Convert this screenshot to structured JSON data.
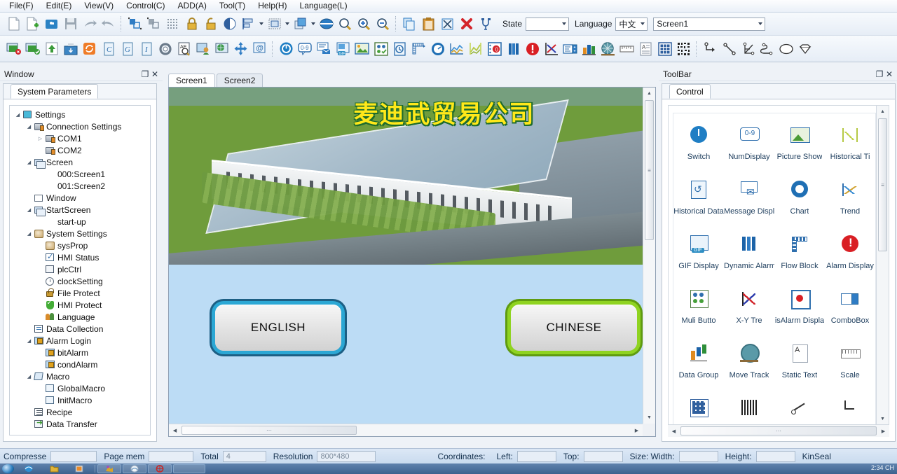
{
  "menu": {
    "items": [
      {
        "label": "File(F)",
        "name": "menu-file"
      },
      {
        "label": "Edit(E)",
        "name": "menu-edit"
      },
      {
        "label": "View(V)",
        "name": "menu-view"
      },
      {
        "label": "Control(C)",
        "name": "menu-control"
      },
      {
        "label": "ADD(A)",
        "name": "menu-add"
      },
      {
        "label": "Tool(T)",
        "name": "menu-tool"
      },
      {
        "label": "Help(H)",
        "name": "menu-help"
      },
      {
        "label": "Language(L)",
        "name": "menu-language"
      }
    ]
  },
  "toolbar_main": {
    "state_label": "State",
    "state_value": "",
    "language_label": "Language",
    "language_value": "中文",
    "screen_value": "Screen1",
    "icons": [
      "new-file-icon",
      "new-project-icon",
      "open-project-icon",
      "save-icon",
      "redo-icon",
      "undo-icon",
      "sep",
      "select-object-icon",
      "group-object-icon",
      "grid-icon",
      "lock-icon",
      "unlock-icon",
      "flip-icon",
      "align-icon",
      "caret",
      "size-icon",
      "caret",
      "layer-icon",
      "caret",
      "fill-icon",
      "zoom-icon",
      "zoom-in-icon",
      "zoom-out-icon",
      "sep",
      "copy-icon",
      "paste-icon",
      "cut-icon",
      "delete-icon",
      "find-icon"
    ]
  },
  "toolbar_second": {
    "icons": [
      "compile-error-icon",
      "compile-ok-icon",
      "upload-icon",
      "usb-download-icon",
      "refresh-icon",
      "c-script-icon",
      "g-script-icon",
      "i-script-icon",
      "settings-gear-icon",
      "text-search-icon",
      "user-manage-icon",
      "network-icon",
      "move-icon",
      "at-address-icon",
      "sep",
      "switch-icon",
      "numdisplay-icon",
      "message-display-icon",
      "gif-display-icon",
      "picture-show-icon",
      "multi-button-icon",
      "historical-data-icon",
      "flow-block-icon",
      "chart-icon",
      "trend-icon",
      "historical-trend-icon",
      "is-alarm-display-icon",
      "dynamic-alarm-list-icon",
      "alarm-display-icon",
      "xy-trend-icon",
      "combobox-icon",
      "data-group-icon",
      "move-track-icon",
      "scale-icon",
      "static-text-icon",
      "grid-table-icon",
      "qrcode-icon",
      "sep",
      "polyline-icon",
      "line-icon",
      "polygon-icon",
      "curve-icon",
      "ellipse-icon",
      "diamond-icon"
    ]
  },
  "left_dock": {
    "title": "Window",
    "restore_icon": "restore-icon",
    "close_icon": "close-icon",
    "tab": "System Parameters",
    "tree": [
      {
        "label": "Settings",
        "depth": 0,
        "twisty": "open",
        "icon": "settings-icon"
      },
      {
        "label": "Connection Settings",
        "depth": 1,
        "twisty": "open",
        "icon": "connection-icon"
      },
      {
        "label": "COM1",
        "depth": 2,
        "twisty": "closed",
        "icon": "com-port-icon"
      },
      {
        "label": "COM2",
        "depth": 2,
        "twisty": "none",
        "icon": "com-port-icon"
      },
      {
        "label": "Screen",
        "depth": 1,
        "twisty": "open",
        "icon": "screen-icon"
      },
      {
        "label": "000:Screen1",
        "depth": 2,
        "twisty": "none",
        "icon": "none"
      },
      {
        "label": "001:Screen2",
        "depth": 2,
        "twisty": "none",
        "icon": "none"
      },
      {
        "label": "Window",
        "depth": 1,
        "twisty": "none",
        "icon": "window-icon"
      },
      {
        "label": "StartScreen",
        "depth": 1,
        "twisty": "open",
        "icon": "screen-icon"
      },
      {
        "label": "start-up",
        "depth": 2,
        "twisty": "none",
        "icon": "none"
      },
      {
        "label": "System Settings",
        "depth": 1,
        "twisty": "open",
        "icon": "system-settings-icon"
      },
      {
        "label": "sysProp",
        "depth": 2,
        "twisty": "none",
        "icon": "system-settings-icon"
      },
      {
        "label": "HMI Status",
        "depth": 2,
        "twisty": "none",
        "icon": "hmi-status-icon"
      },
      {
        "label": "plcCtrl",
        "depth": 2,
        "twisty": "none",
        "icon": "plc-ctrl-icon"
      },
      {
        "label": "clockSetting",
        "depth": 2,
        "twisty": "none",
        "icon": "clock-icon"
      },
      {
        "label": "File Protect",
        "depth": 2,
        "twisty": "none",
        "icon": "lock-icon"
      },
      {
        "label": "HMI Protect",
        "depth": 2,
        "twisty": "none",
        "icon": "shield-icon"
      },
      {
        "label": "Language",
        "depth": 2,
        "twisty": "none",
        "icon": "users-icon"
      },
      {
        "label": "Data Collection",
        "depth": 1,
        "twisty": "none",
        "icon": "data-collection-icon"
      },
      {
        "label": "Alarm Login",
        "depth": 1,
        "twisty": "open",
        "icon": "alarm-login-icon"
      },
      {
        "label": "bitAlarm",
        "depth": 2,
        "twisty": "none",
        "icon": "alarm-login-icon"
      },
      {
        "label": "condAlarm",
        "depth": 2,
        "twisty": "none",
        "icon": "alarm-login-icon"
      },
      {
        "label": "Macro",
        "depth": 1,
        "twisty": "open",
        "icon": "macro-icon"
      },
      {
        "label": "GlobalMacro",
        "depth": 2,
        "twisty": "none",
        "icon": "global-macro-icon"
      },
      {
        "label": "InitMacro",
        "depth": 2,
        "twisty": "none",
        "icon": "init-macro-icon"
      },
      {
        "label": "Recipe",
        "depth": 1,
        "twisty": "none",
        "icon": "recipe-icon"
      },
      {
        "label": "Data Transfer",
        "depth": 1,
        "twisty": "none",
        "icon": "data-transfer-icon"
      }
    ]
  },
  "editor": {
    "tabs": [
      {
        "label": "Screen1",
        "active": true
      },
      {
        "label": "Screen2",
        "active": false
      }
    ],
    "canvas": {
      "title_text": "麦迪武贸易公司",
      "buttons": [
        {
          "label": "ENGLISH",
          "accent": "#2ba7d4",
          "name": "hmi-button-english"
        },
        {
          "label": "CHINESE",
          "accent": "#8fd321",
          "name": "hmi-button-chinese"
        }
      ]
    }
  },
  "right_dock": {
    "title": "ToolBar",
    "tab": "Control",
    "items": [
      {
        "label": "Switch",
        "icon": "switch-icon",
        "cls": "ci-switch"
      },
      {
        "label": "NumDisplay",
        "icon": "numdisplay-icon",
        "cls": "ci-num"
      },
      {
        "label": "Picture Show",
        "icon": "picture-show-icon",
        "cls": "ci-pic"
      },
      {
        "label": "Historical Ti",
        "icon": "historical-trend-icon",
        "cls": "ci-histt"
      },
      {
        "label": "Historical Data",
        "icon": "historical-data-icon",
        "cls": "ci-histd"
      },
      {
        "label": "Message Displä",
        "icon": "message-display-icon",
        "cls": "ci-msg"
      },
      {
        "label": "Chart",
        "icon": "chart-icon",
        "cls": "ci-chart"
      },
      {
        "label": "Trend",
        "icon": "trend-icon",
        "cls": "ci-trend"
      },
      {
        "label": "GIF Display",
        "icon": "gif-display-icon",
        "cls": "ci-gif"
      },
      {
        "label": "Dynamic Alarm List",
        "icon": "dynamic-alarm-list-icon",
        "cls": "ci-dal"
      },
      {
        "label": "Flow Block",
        "icon": "flow-block-icon",
        "cls": "ci-flow"
      },
      {
        "label": "Alarm Display",
        "icon": "alarm-display-icon",
        "cls": "ci-alarm"
      },
      {
        "label": "Muli Butto",
        "icon": "multi-button-icon",
        "cls": "ci-multi"
      },
      {
        "label": "X-Y Tre",
        "icon": "xy-trend-icon",
        "cls": "ci-xy"
      },
      {
        "label": "isAlarm Displa",
        "icon": "is-alarm-display-icon",
        "cls": "ci-isal"
      },
      {
        "label": "ComboBox",
        "icon": "combobox-icon",
        "cls": "ci-combo"
      },
      {
        "label": "Data Group",
        "icon": "data-group-icon",
        "cls": "ci-dg"
      },
      {
        "label": "Move Track",
        "icon": "move-track-icon",
        "cls": "ci-mt"
      },
      {
        "label": "Static Text",
        "icon": "static-text-icon",
        "cls": "ci-st"
      },
      {
        "label": "Scale",
        "icon": "scale-icon",
        "cls": "ci-scale"
      },
      {
        "label": "",
        "icon": "grid-table-icon",
        "cls": "ci-grid"
      },
      {
        "label": "",
        "icon": "qrcode-icon",
        "cls": "ci-qr"
      },
      {
        "label": "",
        "icon": "line-icon",
        "cls": "ci-line"
      },
      {
        "label": "",
        "icon": "polyline-icon",
        "cls": "ci-poly"
      }
    ]
  },
  "statusbar": {
    "compresse_label": "Compresse",
    "compresse_value": "",
    "page_mem_label": "Page mem",
    "page_mem_value": "",
    "total_label": "Total",
    "total_value": "4",
    "resolution_label": "Resolution",
    "resolution_value": "800*480",
    "coordinates_label": "Coordinates:",
    "left_label": "Left:",
    "left_value": "",
    "top_label": "Top:",
    "top_value": "",
    "size_width_label": "Size: Width:",
    "width_value": "",
    "height_label": "Height:",
    "height_value": "",
    "product": "KinSeal"
  },
  "taskbar": {
    "clock": "2:34 CH",
    "items": [
      {
        "name": "taskbar-start-orb",
        "color": "#2c7fc0"
      },
      {
        "name": "taskbar-ie-icon",
        "color": "#3b8ec9"
      },
      {
        "name": "taskbar-explorer-icon",
        "color": "#e0b43a"
      },
      {
        "name": "taskbar-media-icon",
        "color": "#e08a2a"
      },
      {
        "name": "taskbar-paint-icon",
        "color": "#d8a52a"
      },
      {
        "name": "taskbar-app-icon",
        "color": "#dce6f0"
      },
      {
        "name": "taskbar-hmi-icon",
        "color": "#c22a2a"
      }
    ]
  }
}
